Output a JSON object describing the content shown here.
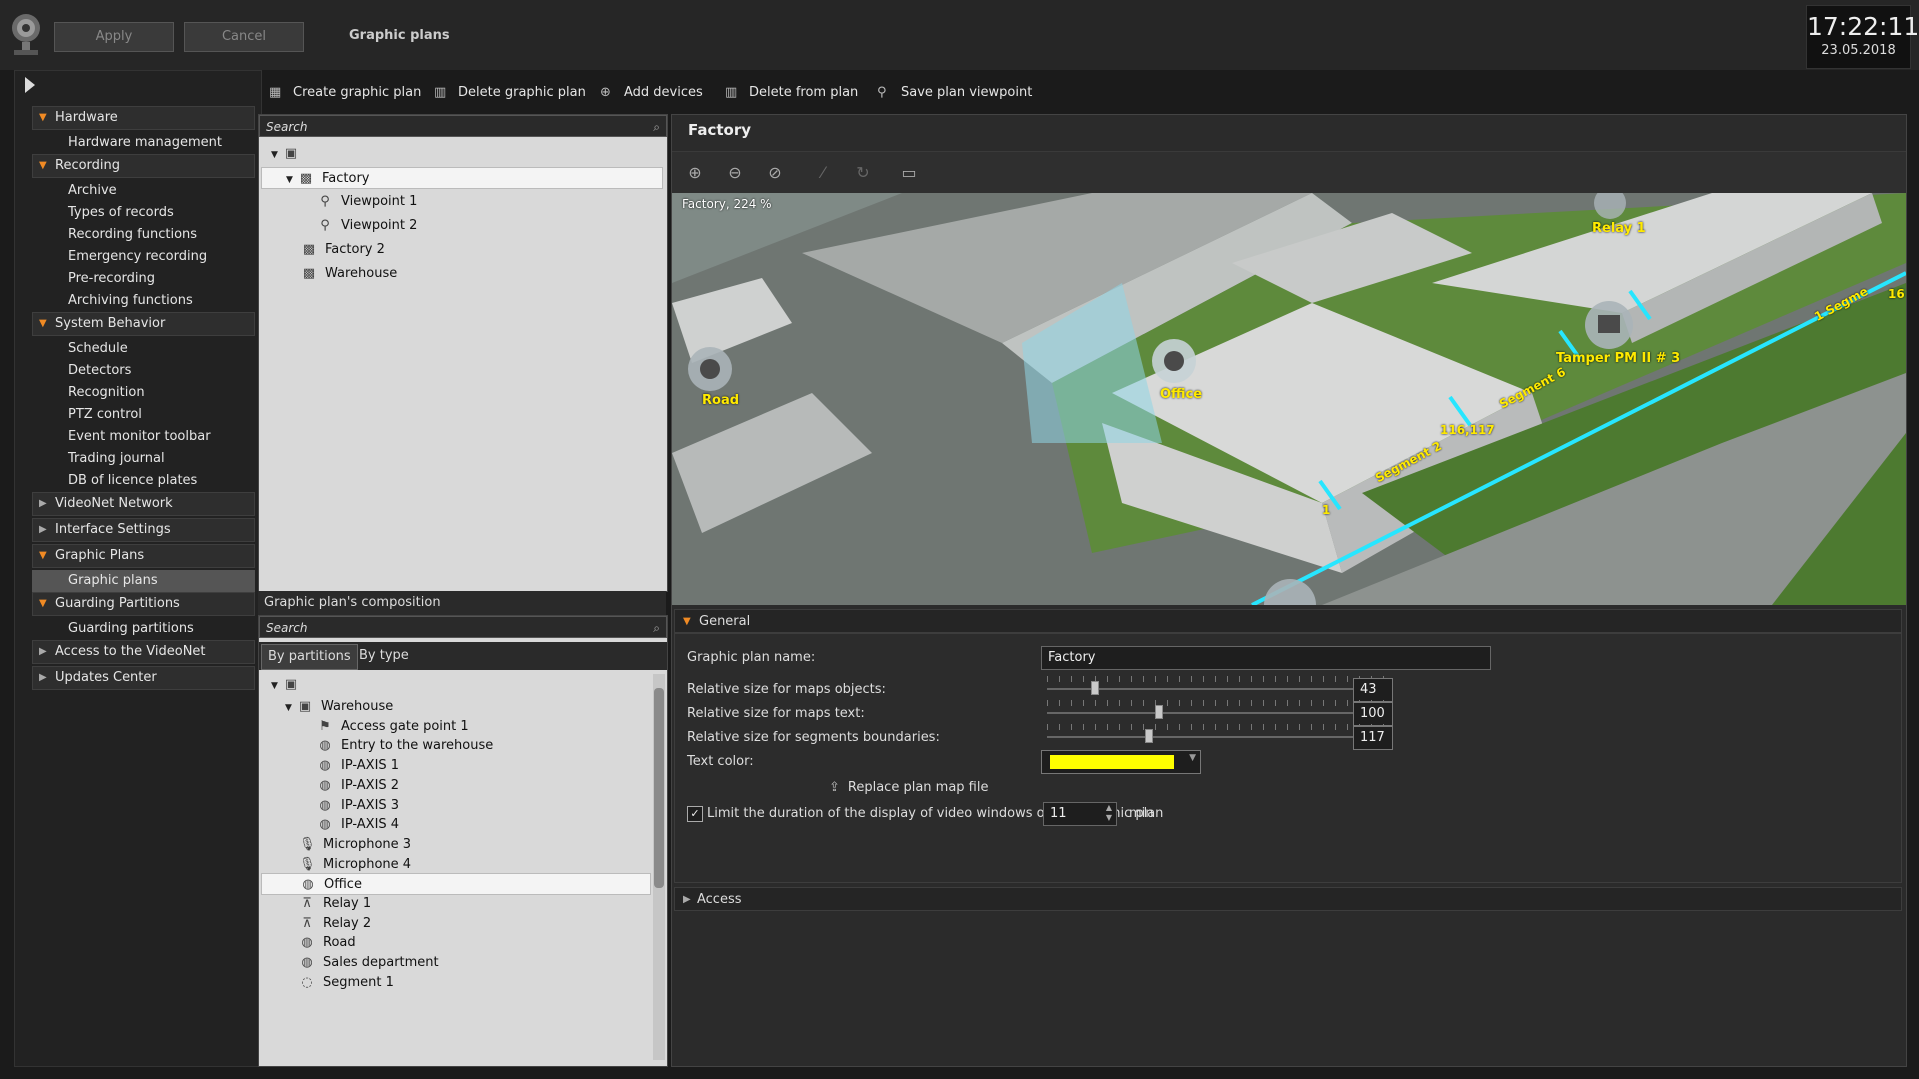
{
  "header": {
    "apply_label": "Apply",
    "cancel_label": "Cancel",
    "title": "Graphic plans",
    "time": "17:22:11",
    "date": "23.05.2018"
  },
  "nav": {
    "categories": [
      {
        "label": "Hardware",
        "items": [
          "Hardware management"
        ]
      },
      {
        "label": "Recording",
        "items": [
          "Archive",
          "Types of records",
          "Recording functions",
          "Emergency recording",
          "Pre-recording",
          "Archiving functions"
        ]
      },
      {
        "label": "System Behavior",
        "items": [
          "Schedule",
          "Detectors",
          "Recognition",
          "PTZ control",
          "Event monitor toolbar",
          "Trading journal",
          "DB of licence plates"
        ]
      },
      {
        "label": "VideoNet Network"
      },
      {
        "label": "Interface Settings"
      },
      {
        "label": "Graphic Plans",
        "items": [
          "Graphic plans"
        ]
      },
      {
        "label": "Guarding Partitions",
        "items": [
          "Guarding partitions"
        ]
      },
      {
        "label": "Access to the VideoNet"
      },
      {
        "label": "Updates Center"
      }
    ]
  },
  "toolbar": {
    "create": "Create graphic plan",
    "delete": "Delete graphic plan",
    "add_devices": "Add devices",
    "delete_from_plan": "Delete from plan",
    "save_viewpoint": "Save plan viewpoint"
  },
  "tree": {
    "search_placeholder": "Search",
    "nodes": [
      "Factory",
      "Viewpoint 1",
      "Viewpoint 2",
      "Factory 2",
      "Warehouse"
    ]
  },
  "composition": {
    "title": "Graphic plan's composition",
    "search_placeholder": "Search",
    "tab_partitions": "By partitions",
    "tab_type": "By type",
    "nodes": [
      "Warehouse",
      "Access gate point 1",
      "Entry to the warehouse",
      "IP-AXIS 1",
      "IP-AXIS 2",
      "IP-AXIS 3",
      "IP-AXIS 4",
      "Microphone 3",
      "Microphone 4",
      "Office",
      "Relay 1",
      "Relay 2",
      "Road",
      "Sales department",
      "Segment 1"
    ]
  },
  "plan": {
    "title": "Factory",
    "map_caption": "Factory, 224 %",
    "labels": {
      "road": "Road",
      "office": "Office",
      "relay1": "Relay 1",
      "tamper": "Tamper PM II # 3",
      "n116": "116,117",
      "n1": "1",
      "n16": "16",
      "seg2": "Segment 2",
      "seg6": "Segment 6",
      "seg1": "1 Segme"
    },
    "general_label": "General",
    "name_label": "Graphic plan name:",
    "name_value": "Factory",
    "size_objects_label": "Relative size for maps objects:",
    "size_objects_value": "43",
    "size_objects_level": 0.14,
    "size_text_label": "Relative size for maps text:",
    "size_text_value": "100",
    "size_text_level": 0.33,
    "size_seg_label": "Relative size for segments boundaries:",
    "size_seg_value": "117",
    "size_seg_level": 0.3,
    "text_color_label": "Text color:",
    "text_color": "#ffff00",
    "replace_label": "Replace plan map file",
    "limit_label": "Limit the duration of the display of video windows on the graphic plan",
    "limit_value": "11",
    "limit_unit": "min",
    "access_label": "Access"
  }
}
